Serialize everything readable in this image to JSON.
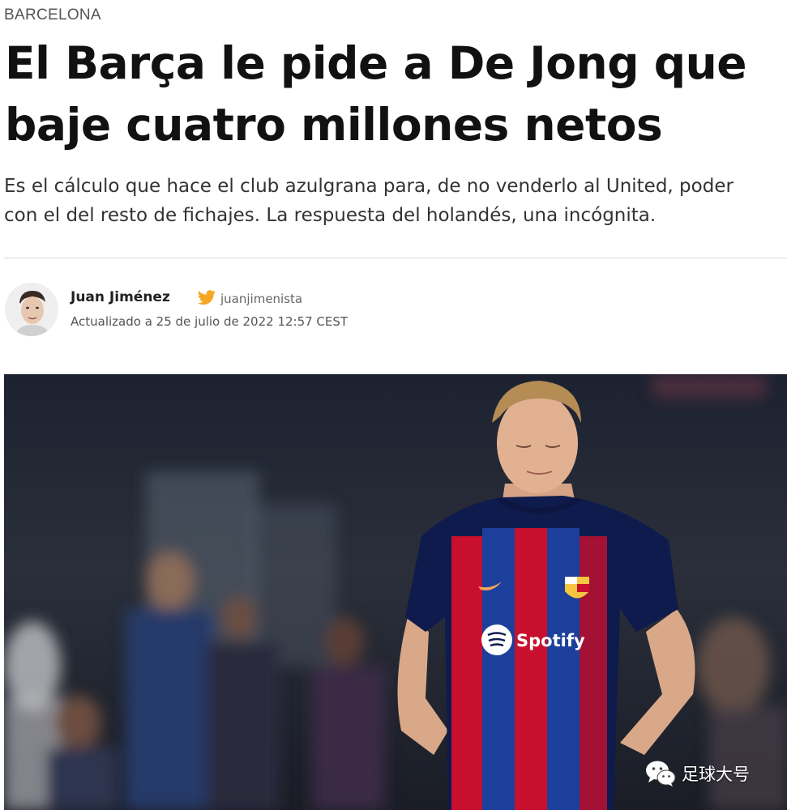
{
  "article": {
    "section": "BARCELONA",
    "headline_line1": "El Barça le pide a De Jong que",
    "headline_line2": "baje cuatro millones netos",
    "standfirst_line1": "Es el cálculo que hace el club azulgrana para, de no venderlo al United, poder",
    "standfirst_line2": "con el del resto de fichajes. La respuesta del holandés, una incógnita."
  },
  "byline": {
    "author": "Juan Jiménez",
    "twitter_icon": "twitter-bird-icon",
    "twitter_handle": "juanjimenista",
    "updated": "Actualizado a 25 de julio de 2022 12:57 CEST"
  },
  "photo": {
    "sponsor_text": "Spotify"
  },
  "watermark": {
    "icon": "wechat-icon",
    "text": "足球大号"
  },
  "colors": {
    "twitter": "#f5a623",
    "blaugrana_blue": "#1d3f9c",
    "blaugrana_red": "#c8102e",
    "shirt_navy": "#0f1b4d"
  }
}
